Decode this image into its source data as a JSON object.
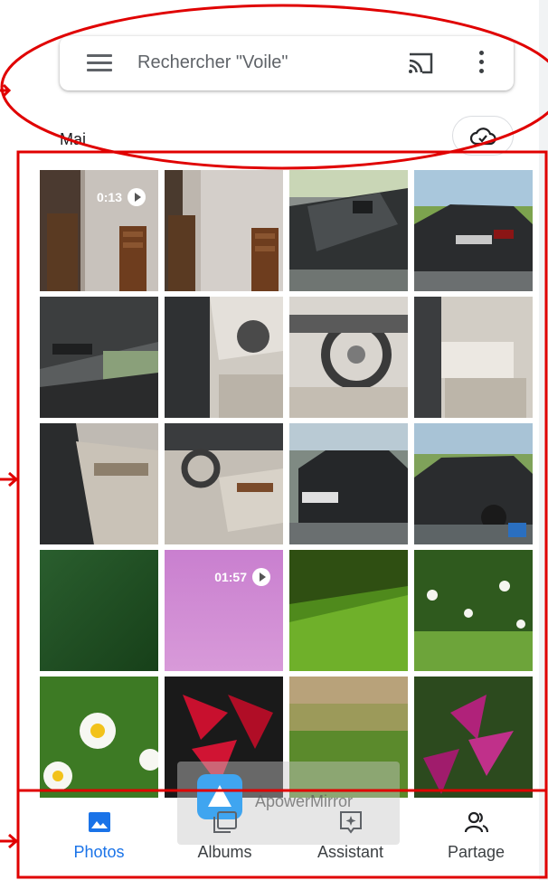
{
  "search": {
    "placeholder": "Rechercher \"Voile\""
  },
  "section": {
    "month": "Mai"
  },
  "grid": {
    "tiles": [
      {
        "kind": "video",
        "duration": "0:13"
      },
      {
        "kind": "photo"
      },
      {
        "kind": "photo"
      },
      {
        "kind": "photo"
      },
      {
        "kind": "photo"
      },
      {
        "kind": "photo"
      },
      {
        "kind": "photo"
      },
      {
        "kind": "photo"
      },
      {
        "kind": "photo"
      },
      {
        "kind": "photo"
      },
      {
        "kind": "photo"
      },
      {
        "kind": "photo"
      },
      {
        "kind": "photo"
      },
      {
        "kind": "video",
        "duration": "01:57"
      },
      {
        "kind": "photo"
      },
      {
        "kind": "photo"
      },
      {
        "kind": "photo"
      },
      {
        "kind": "photo"
      },
      {
        "kind": "photo"
      },
      {
        "kind": "photo"
      }
    ]
  },
  "watermark": {
    "text": "ApowerMirror"
  },
  "nav": {
    "items": [
      {
        "label": "Photos",
        "icon": "photos-icon",
        "active": true
      },
      {
        "label": "Albums",
        "icon": "albums-icon",
        "active": false
      },
      {
        "label": "Assistant",
        "icon": "assistant-icon",
        "active": false
      },
      {
        "label": "Partage",
        "icon": "sharing-icon",
        "active": false
      }
    ]
  },
  "colors": {
    "accent": "#1a73e8",
    "annotation": "#e00000"
  }
}
